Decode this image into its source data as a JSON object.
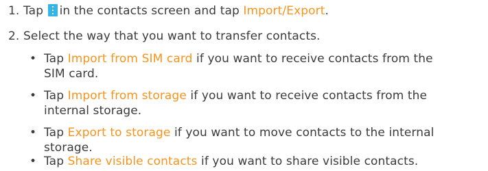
{
  "steps": [
    {
      "number": "1.",
      "pre": "Tap",
      "icon": "menu-more-icon",
      "mid": "in the contacts screen and tap",
      "link": "Import/Export",
      "post": "."
    },
    {
      "number": "2.",
      "text": "Select the way that you want to transfer contacts."
    }
  ],
  "options": [
    {
      "tap": "Tap",
      "link": "Import from SIM card",
      "desc_line1": "if you want to receive contacts from the",
      "desc_line2": "SIM card."
    },
    {
      "tap": "Tap",
      "link": "Import from storage",
      "desc_line1": "if you want to receive contacts from the",
      "desc_line2": "internal storage."
    },
    {
      "tap": "Tap",
      "link": "Export to storage",
      "desc_line1": "if you want to move contacts to the internal",
      "desc_line2": "storage."
    },
    {
      "tap": "Tap",
      "link": "Share visible contacts",
      "desc_line1": "if you want to share visible contacts."
    }
  ],
  "bullet_glyph": "•",
  "colors": {
    "text": "#3b3b3b",
    "highlight": "#f7941d",
    "icon": "#33b5e5"
  }
}
